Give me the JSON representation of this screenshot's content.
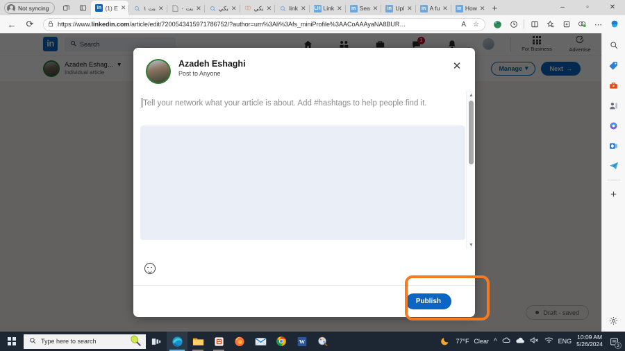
{
  "browser": {
    "profile_label": "Not syncing",
    "tabs": [
      {
        "title": "(1) E",
        "favicon": "linkedin-icon",
        "active": true
      },
      {
        "title": "بت ۱",
        "favicon": "search-icon",
        "active": false
      },
      {
        "title": "بت ۰",
        "favicon": "page-icon",
        "active": false
      },
      {
        "title": "بكي",
        "favicon": "search-icon",
        "active": false
      },
      {
        "title": "بكي",
        "favicon": "brain-icon",
        "active": false
      },
      {
        "title": "link",
        "favicon": "search-icon",
        "active": false
      },
      {
        "title": "Link",
        "favicon": "linkedin-alt-icon",
        "active": false
      },
      {
        "title": "Sea",
        "favicon": "linkedin-icon",
        "active": false
      },
      {
        "title": "Upl",
        "favicon": "linkedin-icon",
        "active": false
      },
      {
        "title": "A fu",
        "favicon": "linkedin-icon",
        "active": false
      },
      {
        "title": "How",
        "favicon": "linkedin-icon",
        "active": false
      }
    ],
    "new_tab_label": "+",
    "window_controls": {
      "minimize": "–",
      "maximize": "▫",
      "close": "✕"
    },
    "back_label": "←",
    "reload_label": "⟳",
    "url_prefix": "https://www.",
    "url_domain": "linkedin.com",
    "url_path": "/article/edit/7200543415971786752/?author=urn%3Ali%3Afs_miniProfile%3AACoAAAyaNA8BUR…",
    "read_aloud_label": "A",
    "favorite_label": "☆",
    "toolbar_icons": [
      "globe-icon",
      "history-icon",
      "split-screen-icon",
      "collections-icon",
      "browser-essentials-icon",
      "copilot-icon"
    ]
  },
  "linkedin": {
    "logo_text": "in",
    "search_placeholder": "Search",
    "nav": [
      {
        "name": "home-icon",
        "glyph": "⌂"
      },
      {
        "name": "my-network-icon",
        "glyph": "⚇"
      },
      {
        "name": "jobs-icon",
        "glyph": "▬"
      },
      {
        "name": "messaging-icon",
        "glyph": "✉",
        "badge": "1"
      },
      {
        "name": "notifications-icon",
        "glyph": "⚑"
      },
      {
        "name": "me-avatar",
        "glyph": ""
      }
    ],
    "for_business_label": "For Business",
    "advertise_label": "Advertise",
    "author_name": "Azadeh Eshag…",
    "author_type": "Individual article",
    "manage_label": "Manage",
    "next_label": "Next",
    "draft_status": "Draft - saved"
  },
  "modal": {
    "author_name": "Azadeh Eshaghi",
    "audience": "Post to Anyone",
    "close_label": "✕",
    "compose_placeholder": "Tell your network what your article is about. Add #hashtags to help people find it.",
    "emoji_label": "emoji-picker",
    "publish_label": "Publish",
    "highlight_color": "#f47b20"
  },
  "sidebar_icons": [
    "search-icon",
    "shopping-tag-icon",
    "tools-icon",
    "contacts-icon",
    "copilot-icon",
    "outlook-icon",
    "telegram-icon",
    "add-icon",
    "settings-icon"
  ],
  "taskbar": {
    "search_placeholder": "Type here to search",
    "apps": [
      "task-view-icon",
      "edge-icon",
      "file-explorer-icon",
      "store-icon",
      "firefox-icon",
      "mail-icon",
      "chrome-icon",
      "word-icon",
      "paint3d-icon"
    ],
    "weather_temp": "77°F",
    "weather_cond": "Clear",
    "language": "ENG",
    "time": "10:09 AM",
    "date": "5/26/2024",
    "notification_count": "3"
  }
}
